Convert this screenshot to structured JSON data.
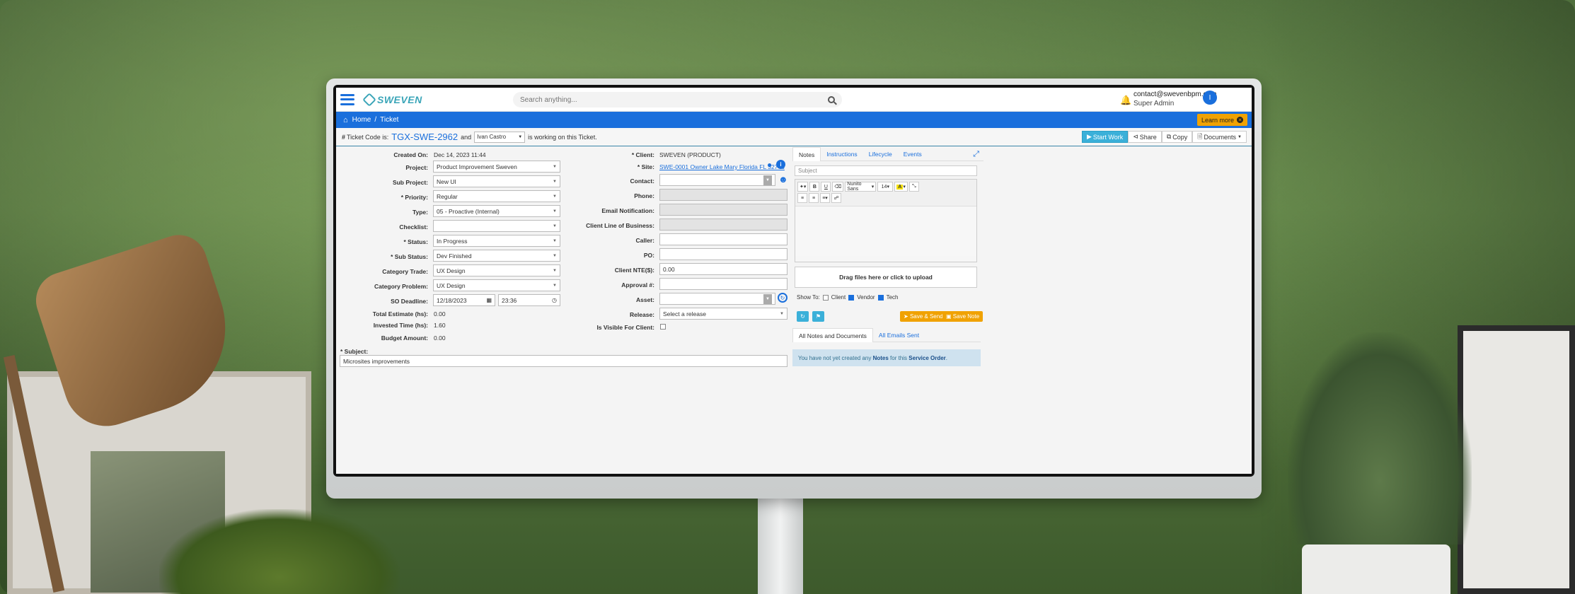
{
  "topbar": {
    "search_placeholder": "Search anything...",
    "logo_text": "SWEVEN",
    "user_email": "contact@swevenbpm.com",
    "user_role": "Super Admin",
    "avatar_initial": "I"
  },
  "breadcrumb": {
    "home": "Home",
    "current": "Ticket",
    "learn_more": "Learn more"
  },
  "ticketbar": {
    "prefix": "Ticket Code is:",
    "code": "TGX-SWE-2962",
    "and": "and",
    "worker": "Ivan Castro",
    "working_text": "is working on this Ticket.",
    "actions": [
      "Start Work",
      "Share",
      "Copy",
      "Documents"
    ]
  },
  "left_form": {
    "created_on_label": "Created On:",
    "created_on_value": "Dec 14, 2023 11:44",
    "project_label": "Project:",
    "project_value": "Product Improvement Sweven",
    "subproject_label": "Sub Project:",
    "subproject_value": "New UI",
    "priority_label": "* Priority:",
    "priority_value": "Regular",
    "type_label": "Type:",
    "type_value": "05 - Proactive (Internal)",
    "checklist_label": "Checklist:",
    "checklist_value": "",
    "status_label": "* Status:",
    "status_value": "In Progress",
    "substatus_label": "* Sub Status:",
    "substatus_value": "Dev Finished",
    "cat_trade_label": "Category Trade:",
    "cat_trade_value": "UX Design",
    "cat_problem_label": "Category Problem:",
    "cat_problem_value": "UX Design",
    "so_deadline_label": "SO Deadline:",
    "so_deadline_date": "12/18/2023",
    "so_deadline_time": "23:36",
    "total_estimate_label": "Total Estimate (hs):",
    "total_estimate_value": "0.00",
    "invested_time_label": "Invested Time (hs):",
    "invested_time_value": "1.60",
    "budget_label": "Budget Amount:",
    "budget_value": "0.00",
    "subject_label": "* Subject:",
    "subject_value": "Microsites improvements"
  },
  "mid_form": {
    "client_label": "* Client:",
    "client_value": "SWEVEN (PRODUCT)",
    "site_label": "* Site:",
    "site_value": "SWE-0001 Owner Lake Mary Florida FL 32746",
    "contact_label": "Contact:",
    "phone_label": "Phone:",
    "email_notif_label": "Email Notification:",
    "client_lob_label": "Client Line of Business:",
    "caller_label": "Caller:",
    "po_label": "PO:",
    "client_nte_label": "Client NTE($):",
    "client_nte_value": "0.00",
    "approval_label": "Approval #:",
    "asset_label": "Asset:",
    "release_label": "Release:",
    "release_value": "Select a release",
    "visible_label": "Is Visible For Client:"
  },
  "notes": {
    "tabs": [
      "Notes",
      "Instructions",
      "Lifecycle",
      "Events"
    ],
    "subject_placeholder": "Subject",
    "font_name": "Nunito Sans",
    "font_size": "14",
    "dropzone": "Drag files here or click to upload",
    "show_to_label": "Show To:",
    "show_to": [
      {
        "label": "Client",
        "checked": false
      },
      {
        "label": "Vendor",
        "checked": true
      },
      {
        "label": "Tech",
        "checked": true
      }
    ],
    "save_send": "Save & Send",
    "save_note": "Save Note",
    "bottom_tabs": [
      "All Notes and Documents",
      "All Emails Sent"
    ],
    "info_prefix": "You have not yet created any",
    "info_notes": "Notes",
    "info_mid": "for this",
    "info_so": "Service Order",
    "info_end": "."
  },
  "colors": {
    "brand_blue": "#1a6fdc",
    "accent_orange": "#f0a202",
    "info_cyan": "#3bb0d9"
  }
}
